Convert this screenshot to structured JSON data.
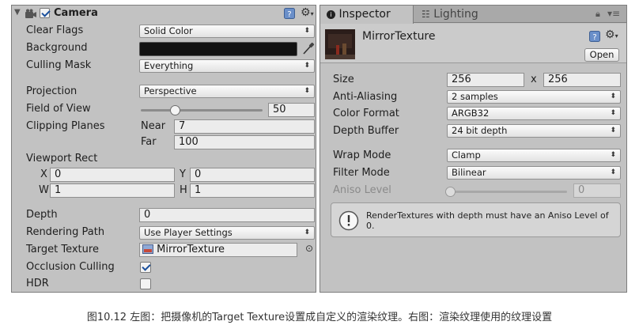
{
  "camera": {
    "title": "Camera",
    "enabled": true,
    "clear_flags": {
      "label": "Clear Flags",
      "value": "Solid Color"
    },
    "background": {
      "label": "Background",
      "color": "#121212"
    },
    "culling_mask": {
      "label": "Culling Mask",
      "value": "Everything"
    },
    "projection": {
      "label": "Projection",
      "value": "Perspective"
    },
    "field_of_view": {
      "label": "Field of View",
      "value": "50",
      "slider_fraction": 0.28
    },
    "clipping_planes": {
      "label": "Clipping Planes",
      "near_label": "Near",
      "near": "7",
      "far_label": "Far",
      "far": "100"
    },
    "viewport_rect": {
      "label": "Viewport Rect",
      "x_label": "X",
      "x": "0",
      "y_label": "Y",
      "y": "0",
      "w_label": "W",
      "w": "1",
      "h_label": "H",
      "h": "1"
    },
    "depth": {
      "label": "Depth",
      "value": "0"
    },
    "rendering_path": {
      "label": "Rendering Path",
      "value": "Use Player Settings"
    },
    "target_texture": {
      "label": "Target Texture",
      "value": "MirrorTexture"
    },
    "occlusion_culling": {
      "label": "Occlusion Culling",
      "checked": true
    },
    "hdr": {
      "label": "HDR",
      "checked": false
    }
  },
  "tabs": {
    "inspector": "Inspector",
    "lighting": "Lighting"
  },
  "texture": {
    "name": "MirrorTexture",
    "open_label": "Open",
    "size": {
      "label": "Size",
      "width": "256",
      "x": "x",
      "height": "256"
    },
    "anti_aliasing": {
      "label": "Anti-Aliasing",
      "value": "2 samples"
    },
    "color_format": {
      "label": "Color Format",
      "value": "ARGB32"
    },
    "depth_buffer": {
      "label": "Depth Buffer",
      "value": "24 bit depth"
    },
    "wrap_mode": {
      "label": "Wrap Mode",
      "value": "Clamp"
    },
    "filter_mode": {
      "label": "Filter Mode",
      "value": "Bilinear"
    },
    "aniso_level": {
      "label": "Aniso Level",
      "value": "0",
      "slider_fraction": 0.0
    },
    "info": "RenderTextures with depth must have an Aniso Level of 0."
  },
  "caption": "图10.12 左图：把摄像机的Target Texture设置成自定义的渲染纹理。右图：渲染纹理使用的纹理设置",
  "colors": {
    "panel": "#c2c2c2",
    "field": "#f3f3f3",
    "accent": "#1a4f9c"
  }
}
